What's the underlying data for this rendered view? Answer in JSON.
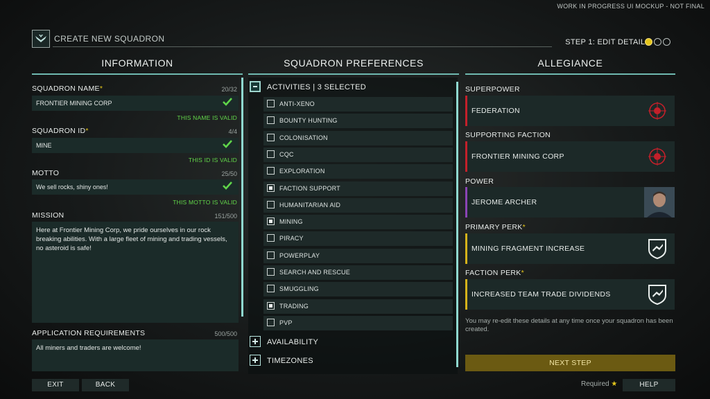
{
  "banner": "WORK IN PROGRESS UI MOCKUP - NOT FINAL",
  "header": {
    "title": "CREATE NEW SQUADRON",
    "step_label": "STEP 1: EDIT DETAILS",
    "steps_total": 3,
    "step_active": 1
  },
  "columns": {
    "information": "INFORMATION",
    "preferences": "SQUADRON PREFERENCES",
    "allegiance": "ALLEGIANCE"
  },
  "info": {
    "name": {
      "label": "SQUADRON NAME",
      "required_mark": "*",
      "count": "20/32",
      "value": "FRONTIER MINING CORP",
      "valid": "THIS NAME IS VALID"
    },
    "id": {
      "label": "SQUADRON ID",
      "required_mark": "*",
      "count": "4/4",
      "value": "MINE",
      "valid": "THIS ID IS VALID"
    },
    "motto": {
      "label": "MOTTO",
      "count": "25/50",
      "value": "We sell rocks, shiny ones!",
      "valid": "THIS MOTTO IS VALID"
    },
    "mission": {
      "label": "MISSION",
      "count": "151/500",
      "value": "Here at Frontier Mining Corp, we pride ourselves in our rock breaking abilities. With a large fleet of mining and trading vessels, no asteroid is safe!"
    },
    "requirements": {
      "label": "APPLICATION REQUIREMENTS",
      "count": "500/500",
      "value": "All miners and traders are welcome!"
    }
  },
  "buttons": {
    "exit": "EXIT",
    "back": "BACK",
    "next": "NEXT STEP",
    "help": "HELP"
  },
  "prefs": {
    "activities_header": "ACTIVITIES | 3 SELECTED",
    "activities": [
      {
        "label": "ANTI-XENO",
        "checked": false
      },
      {
        "label": "BOUNTY HUNTING",
        "checked": false
      },
      {
        "label": "COLONISATION",
        "checked": false
      },
      {
        "label": "CQC",
        "checked": false
      },
      {
        "label": "EXPLORATION",
        "checked": false
      },
      {
        "label": "FACTION SUPPORT",
        "checked": true
      },
      {
        "label": "HUMANITARIAN AID",
        "checked": false
      },
      {
        "label": "MINING",
        "checked": true
      },
      {
        "label": "PIRACY",
        "checked": false
      },
      {
        "label": "POWERPLAY",
        "checked": false
      },
      {
        "label": "SEARCH AND RESCUE",
        "checked": false
      },
      {
        "label": "SMUGGLING",
        "checked": false
      },
      {
        "label": "TRADING",
        "checked": true
      },
      {
        "label": "PVP",
        "checked": false
      }
    ],
    "availability": "AVAILABILITY",
    "timezones": "TIMEZONES"
  },
  "allegiance": {
    "superpower": {
      "label": "SUPERPOWER",
      "value": "FEDERATION",
      "bar_color": "#c3202a",
      "icon": "federation-emblem-icon"
    },
    "supporting_faction": {
      "label": "SUPPORTING FACTION",
      "value": "FRONTIER MINING CORP",
      "bar_color": "#c3202a",
      "icon": "federation-emblem-icon"
    },
    "power": {
      "label": "POWER",
      "value": "JEROME ARCHER",
      "bar_color": "#8a44b4",
      "icon": "portrait-icon"
    },
    "primary_perk": {
      "label": "PRIMARY PERK",
      "required_mark": "*",
      "value": "MINING FRAGMENT INCREASE",
      "bar_color": "#d5b21a",
      "icon": "perk-shield-icon"
    },
    "faction_perk": {
      "label": "FACTION PERK",
      "required_mark": "*",
      "value": "INCREASED TEAM TRADE DIVIDENDS",
      "bar_color": "#d5b21a",
      "icon": "perk-shield-icon"
    },
    "note": "You may re-edit these details at any time once your squadron has been created."
  },
  "footer": {
    "required_label": "Required",
    "required_star": "★"
  }
}
